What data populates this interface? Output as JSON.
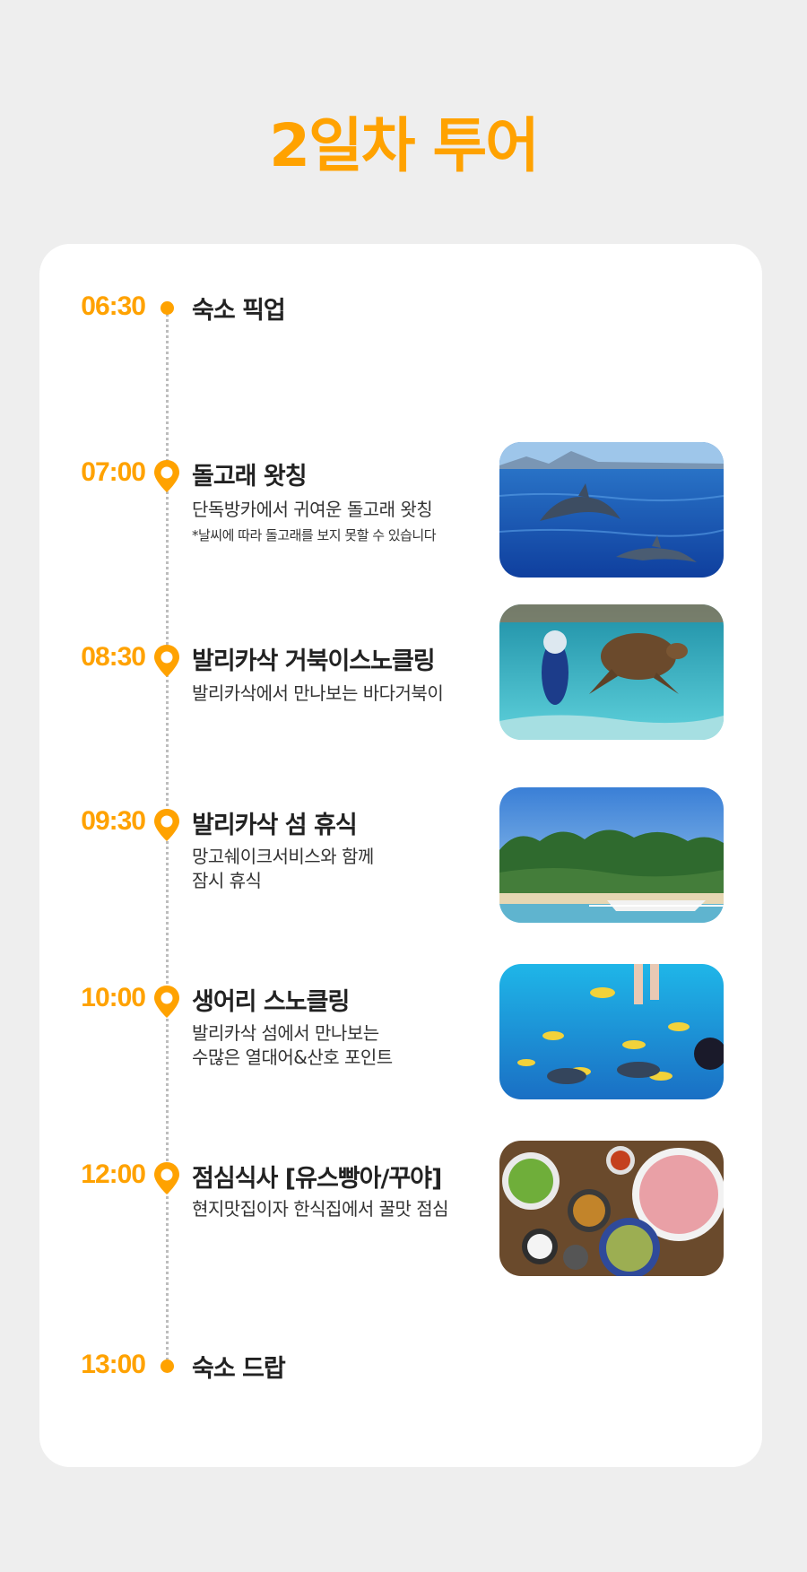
{
  "page": {
    "title": "2일차 투어"
  },
  "schedule": [
    {
      "time": "06:30",
      "title": "숙소 픽업"
    },
    {
      "time": "07:00",
      "title": "돌고래 왓칭",
      "desc": [
        "단독방카에서 귀여운 돌고래 왓칭"
      ],
      "note": "*날씨에 따라 돌고래를 보지 못할 수 있습니다",
      "image": "dolphin-photo"
    },
    {
      "time": "08:30",
      "title": "발리카삭 거북이스노클링",
      "desc": [
        "발리카삭에서 만나보는 바다거북이"
      ],
      "image": "sea-turtle-snorkeling-photo"
    },
    {
      "time": "09:30",
      "title": "발리카삭 섬 휴식",
      "desc": [
        "망고쉐이크서비스와 함께",
        "잠시 휴식"
      ],
      "image": "island-beach-photo"
    },
    {
      "time": "10:00",
      "title": "생어리 스노클링",
      "desc": [
        "발리카삭 섬에서 만나보는",
        "수많은 열대어&산호 포인트"
      ],
      "image": "tropical-fish-photo"
    },
    {
      "time": "12:00",
      "title": "점심식사 [유스빵아/꾸야]",
      "desc": [
        "현지맛집이자 한식집에서 꿀맛 점심"
      ],
      "image": "korean-bbq-lunch-photo"
    },
    {
      "time": "13:00",
      "title": "숙소 드랍"
    }
  ],
  "colors": {
    "accent": "#ffa200",
    "background": "#eeeeee",
    "card": "#ffffff",
    "text": "#222222"
  }
}
